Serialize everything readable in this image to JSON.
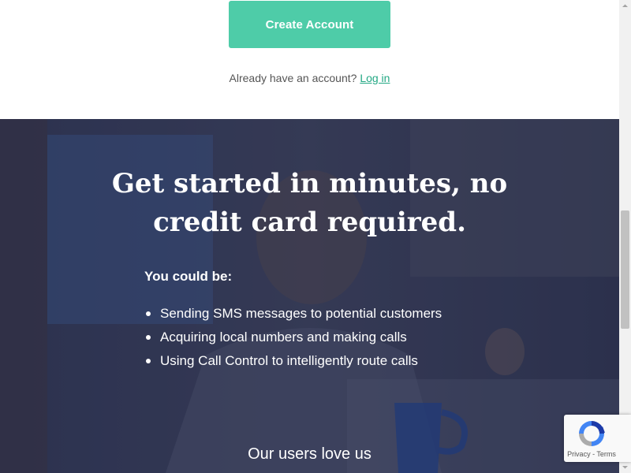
{
  "signup": {
    "create_account_label": "Create Account",
    "already_text": "Already have an account? ",
    "login_link": "Log in"
  },
  "hero": {
    "headline_line1": "Get started in minutes, no",
    "headline_line2": "credit card required.",
    "subhead": "You could be:",
    "bullets": [
      "Sending SMS messages to potential customers",
      "Acquiring local numbers and making calls",
      "Using Call Control to intelligently route calls"
    ],
    "testimonials_heading": "Our users love us"
  },
  "recaptcha": {
    "privacy": "Privacy",
    "separator": " - ",
    "terms": "Terms",
    "icon": "recaptcha-logo"
  },
  "colors": {
    "accent": "#4ecca8",
    "link": "#23a884",
    "hero_overlay": "#2f344f"
  }
}
